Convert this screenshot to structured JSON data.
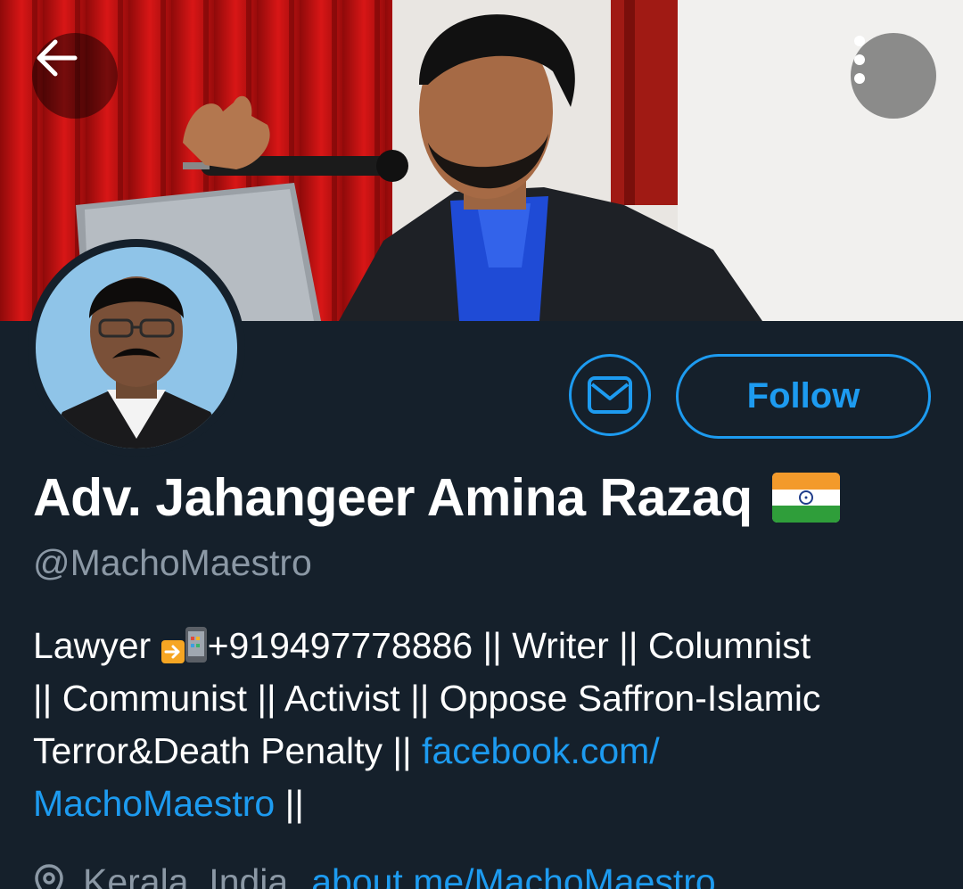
{
  "header": {
    "back_icon": "arrow-left-icon",
    "more_icon": "more-vertical-icon"
  },
  "profile": {
    "display_name": "Adv. Jahangeer Amina Razaq",
    "flag_icon": "india-flag-icon",
    "handle": "@MachoMaestro",
    "follow_label": "Follow",
    "message_icon": "envelope-icon"
  },
  "bio": {
    "line1_a": "Lawyer ",
    "line1_b": "+919497778886 || Writer || Columnist",
    "line2": "|| Communist || Activist || Oppose Saffron-Islamic",
    "line3_a": "Terror&Death Penalty || ",
    "line3_link": "facebook.com/",
    "line4_link": "MachoMaestro",
    "line4_b": " ||"
  },
  "meta": {
    "location": "Kerala, India",
    "website": "about.me/MachoMaestro"
  },
  "colors": {
    "background": "#15202b",
    "accent": "#1d9bf0",
    "secondary_text": "#8b98a5",
    "primary_text": "#ffffff"
  }
}
